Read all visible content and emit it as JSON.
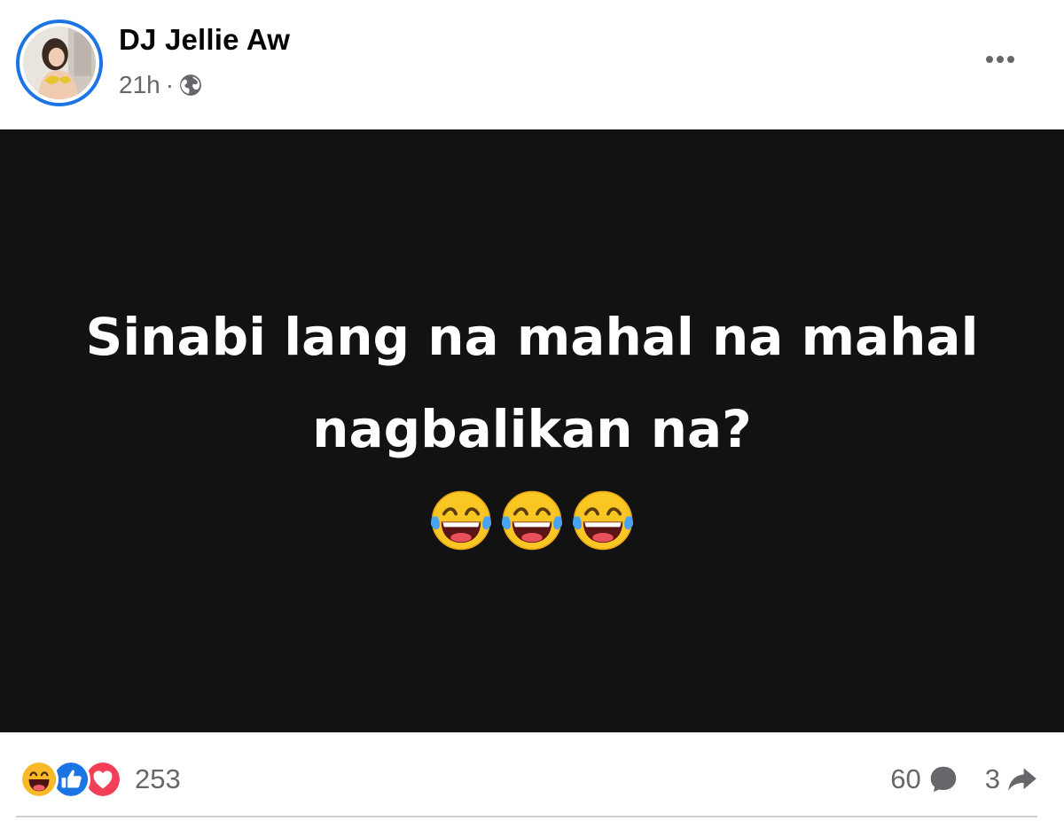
{
  "post": {
    "author": "DJ Jellie Aw",
    "time": "21h",
    "separator": "·",
    "privacy_icon": "globe-icon",
    "menu_icon": "more-options-icon",
    "background_color": "#121212",
    "text_line1": "Sinabi lang na mahal na mahal",
    "text_line2": "nagbalikan na?",
    "emoji": "laughing-with-tears-emoji",
    "emoji_count": 3
  },
  "footer": {
    "reaction_icons": [
      "haha-reaction-icon",
      "like-reaction-icon",
      "love-reaction-icon"
    ],
    "reaction_count": "253",
    "comment_count": "60",
    "share_count": "3"
  },
  "colors": {
    "accent": "#1b74e4",
    "meta_text": "#65676b",
    "author_text": "#050505"
  }
}
